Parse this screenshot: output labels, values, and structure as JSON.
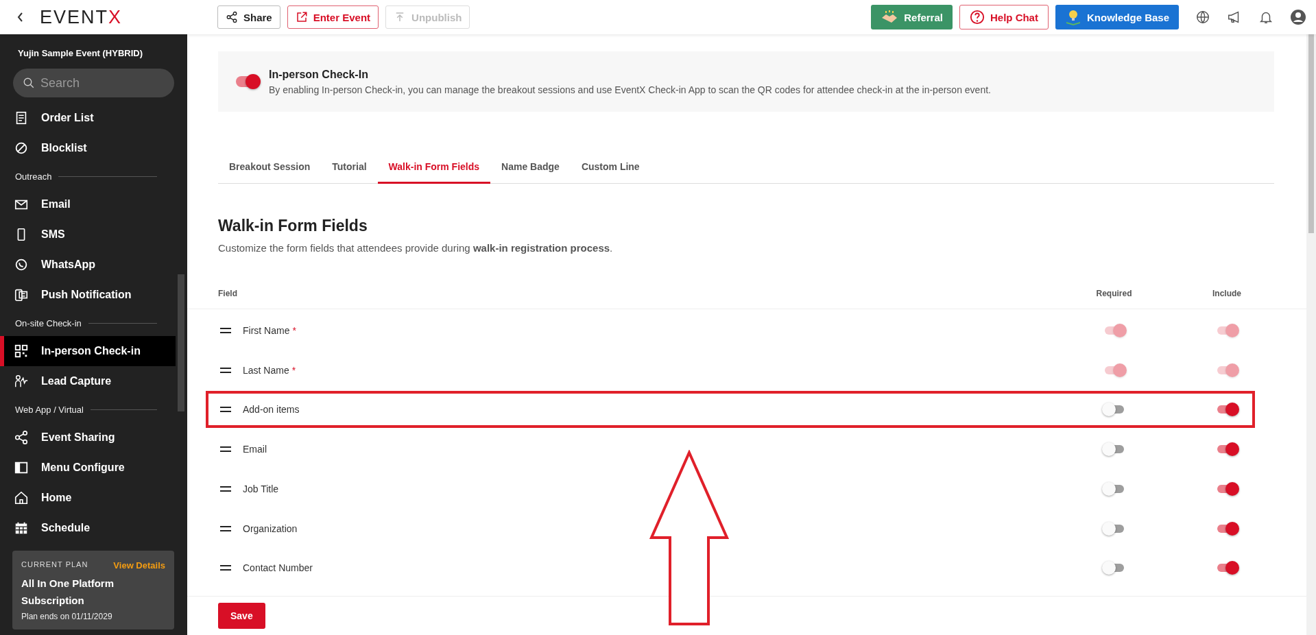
{
  "topbar": {
    "logo": {
      "text": "EVENT",
      "accent": "X"
    },
    "actions": [
      {
        "label": "Share",
        "kind": "plain",
        "disabled": false
      },
      {
        "label": "Enter Event",
        "kind": "outline-red",
        "disabled": false
      },
      {
        "label": "Unpublish",
        "kind": "plain",
        "disabled": true
      }
    ],
    "links": [
      {
        "label": "Referral",
        "kind": "green"
      },
      {
        "label": "Help Chat",
        "kind": "outline-red"
      },
      {
        "label": "Knowledge Base",
        "kind": "blue"
      }
    ]
  },
  "sidebar": {
    "event_title": "Yujin Sample Event (HYBRID)",
    "search": {
      "placeholder": "Search"
    },
    "items": [
      {
        "kind": "item",
        "label": "Order List",
        "selected": false
      },
      {
        "kind": "item",
        "label": "Blocklist",
        "selected": false
      },
      {
        "kind": "section",
        "label": "Outreach"
      },
      {
        "kind": "item",
        "label": "Email",
        "selected": false
      },
      {
        "kind": "item",
        "label": "SMS",
        "selected": false
      },
      {
        "kind": "item",
        "label": "WhatsApp",
        "selected": false
      },
      {
        "kind": "item",
        "label": "Push Notification",
        "selected": false
      },
      {
        "kind": "section",
        "label": "On-site Check-in"
      },
      {
        "kind": "item",
        "label": "In-person Check-in",
        "selected": true
      },
      {
        "kind": "item",
        "label": "Lead Capture",
        "selected": false
      },
      {
        "kind": "section",
        "label": "Web App / Virtual"
      },
      {
        "kind": "item",
        "label": "Event Sharing",
        "selected": false
      },
      {
        "kind": "item",
        "label": "Menu Configure",
        "selected": false
      },
      {
        "kind": "item",
        "label": "Home",
        "selected": false
      },
      {
        "kind": "item",
        "label": "Schedule",
        "selected": false
      }
    ],
    "plan": {
      "caption": "CURRENT PLAN",
      "link": "View Details",
      "name": "All In One Platform Subscription",
      "ends": "Plan ends on 01/11/2029"
    }
  },
  "banner": {
    "on": true,
    "title": "In-person Check-In",
    "text": "By enabling In-person Check-in, you can manage the breakout sessions and use EventX Check-in App to scan the QR codes for attendee check-in at the in-person event."
  },
  "tabs": [
    {
      "label": "Breakout Session",
      "selected": false
    },
    {
      "label": "Tutorial",
      "selected": false
    },
    {
      "label": "Walk-in Form Fields",
      "selected": true
    },
    {
      "label": "Name Badge",
      "selected": false
    },
    {
      "label": "Custom Line",
      "selected": false
    }
  ],
  "section": {
    "title": "Walk-in Form Fields",
    "description": "Customize the form fields that attendees provide during **walk-in registration process**."
  },
  "table": {
    "columns": [
      "Field",
      "Required",
      "Include"
    ],
    "fields": [
      {
        "name": "First Name",
        "marker": "*",
        "highlighted": false,
        "required": {
          "on": true,
          "disabled": true
        },
        "include": {
          "on": true,
          "disabled": true
        }
      },
      {
        "name": "Last Name",
        "marker": "*",
        "highlighted": false,
        "required": {
          "on": true,
          "disabled": true
        },
        "include": {
          "on": true,
          "disabled": true
        }
      },
      {
        "name": "Add-on items",
        "highlighted": true,
        "required": {
          "on": false,
          "disabled": false
        },
        "include": {
          "on": true,
          "disabled": false
        }
      },
      {
        "name": "Email",
        "highlighted": false,
        "required": {
          "on": false,
          "disabled": false
        },
        "include": {
          "on": true,
          "disabled": false
        }
      },
      {
        "name": "Job Title",
        "highlighted": false,
        "required": {
          "on": false,
          "disabled": false
        },
        "include": {
          "on": true,
          "disabled": false
        }
      },
      {
        "name": "Organization",
        "highlighted": false,
        "required": {
          "on": false,
          "disabled": false
        },
        "include": {
          "on": true,
          "disabled": false
        }
      },
      {
        "name": "Contact Number",
        "highlighted": false,
        "required": {
          "on": false,
          "disabled": false
        },
        "include": {
          "on": true,
          "disabled": false
        }
      }
    ]
  },
  "footer": {
    "save": "Save"
  }
}
